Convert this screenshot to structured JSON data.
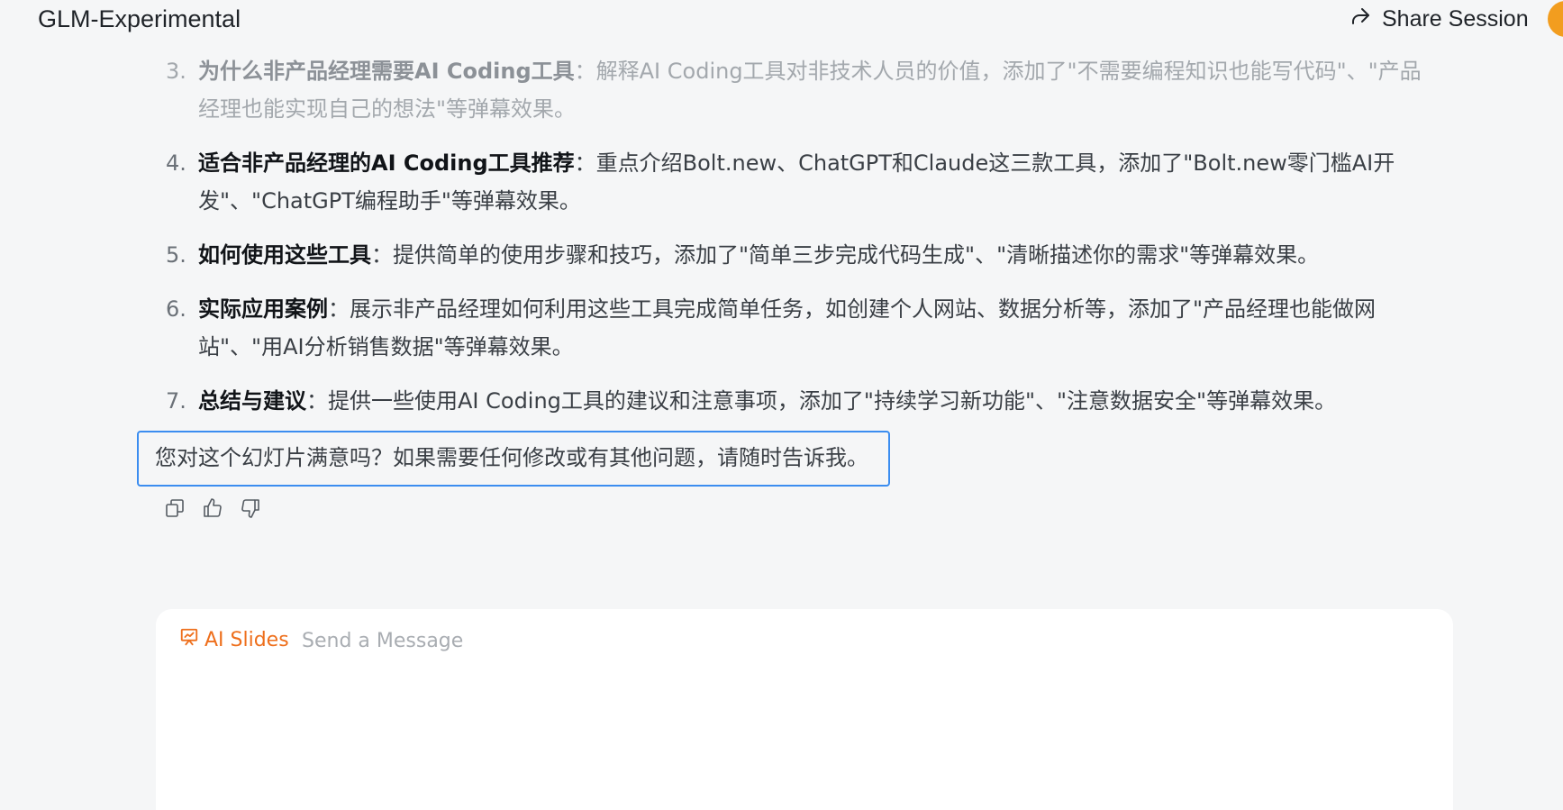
{
  "header": {
    "app_title": "GLM-Experimental",
    "share_label": "Share Session"
  },
  "list": [
    {
      "num": "3.",
      "title": "为什么非产品经理需要AI Coding工具",
      "text": "：解释AI Coding工具对非技术人员的价值，添加了\"不需要编程知识也能写代码\"、\"产品经理也能实现自己的想法\"等弹幕效果。"
    },
    {
      "num": "4.",
      "title": "适合非产品经理的AI Coding工具推荐",
      "text": "：重点介绍Bolt.new、ChatGPT和Claude这三款工具，添加了\"Bolt.new零门槛AI开发\"、\"ChatGPT编程助手\"等弹幕效果。"
    },
    {
      "num": "5.",
      "title": "如何使用这些工具",
      "text": "：提供简单的使用步骤和技巧，添加了\"简单三步完成代码生成\"、\"清晰描述你的需求\"等弹幕效果。"
    },
    {
      "num": "6.",
      "title": "实际应用案例",
      "text": "：展示非产品经理如何利用这些工具完成简单任务，如创建个人网站、数据分析等，添加了\"产品经理也能做网站\"、\"用AI分析销售数据\"等弹幕效果。"
    },
    {
      "num": "7.",
      "title": "总结与建议",
      "text": "：提供一些使用AI Coding工具的建议和注意事项，添加了\"持续学习新功能\"、\"注意数据安全\"等弹幕效果。"
    }
  ],
  "closing_note": "您对这个幻灯片满意吗？如果需要任何修改或有其他问题，请随时告诉我。",
  "composer": {
    "mode_label": "AI Slides",
    "placeholder": "Send a Message"
  },
  "colors": {
    "accent_orange": "#ee6f1c",
    "focus_blue": "#3b8df0",
    "avatar_orange": "#f29d1f"
  }
}
